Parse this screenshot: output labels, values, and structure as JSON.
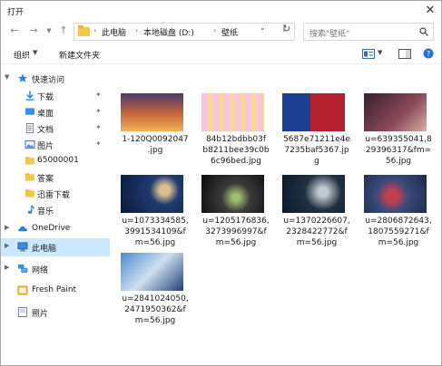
{
  "window": {
    "title": "打开",
    "close_glyph": "✕"
  },
  "address": {
    "breadcrumbs": [
      "此电脑",
      "本地磁盘 (D:)",
      "壁纸"
    ],
    "search_placeholder": "搜索\"壁纸\""
  },
  "toolbar": {
    "organize_label": "组织",
    "new_folder_label": "新建文件夹"
  },
  "sidebar": {
    "items": [
      {
        "label": "快速访问",
        "icon": "star-icon"
      },
      {
        "label": "下载",
        "icon": "download-icon",
        "pinned": true
      },
      {
        "label": "桌面",
        "icon": "desktop-icon",
        "pinned": true
      },
      {
        "label": "文档",
        "icon": "document-icon",
        "pinned": true
      },
      {
        "label": "图片",
        "icon": "picture-icon",
        "pinned": true
      },
      {
        "label": "65000001",
        "icon": "folder-icon"
      },
      {
        "label": "答案",
        "icon": "folder-icon"
      },
      {
        "label": "迅雷下载",
        "icon": "folder-icon"
      },
      {
        "label": "音乐",
        "icon": "music-icon"
      },
      {
        "label": "OneDrive",
        "icon": "cloud-icon"
      },
      {
        "label": "此电脑",
        "icon": "computer-icon",
        "selected": true
      },
      {
        "label": "网络",
        "icon": "network-icon"
      },
      {
        "label": "Fresh Paint",
        "icon": "app-icon"
      },
      {
        "label": "照片",
        "icon": "photos-icon"
      }
    ]
  },
  "files": [
    {
      "name": "1-120Q0092047\n.jpg",
      "colors": [
        "#3a2a4a",
        "#e8863a",
        "#f3b25a"
      ]
    },
    {
      "name": "84b12bdbb03f\nb8211bee39c0b\n6c96bed.jpg",
      "colors": [
        "#f6c8d6",
        "#f2a8c0",
        "#f7d98a"
      ]
    },
    {
      "name": "5687e71211e4e\n7235baf5367.jp\ng",
      "colors": [
        "#1d3f93",
        "#b5212e",
        "#f0f0f0"
      ]
    },
    {
      "name": "u=639355041,8\n29396317&fm=\n56.jpg",
      "colors": [
        "#4b2a3a",
        "#9a5a6a",
        "#d8b0a0"
      ]
    },
    {
      "name": "u=1073334585,\n3991534109&f\nm=56.jpg",
      "colors": [
        "#0a1a3a",
        "#203a70",
        "#d8c090"
      ]
    },
    {
      "name": "u=1205176836,\n3273996997&f\nm=56.jpg",
      "colors": [
        "#0a0a0a",
        "#3a3a3a",
        "#a0c070"
      ]
    },
    {
      "name": "u=1370226607,\n2328422772&f\nm=56.jpg",
      "colors": [
        "#0a1a2a",
        "#203040",
        "#c0c8d0"
      ]
    },
    {
      "name": "u=2806872643,\n1807559271&f\nm=56.jpg",
      "colors": [
        "#1a2a4a",
        "#3a4a7a",
        "#c04050"
      ]
    },
    {
      "name": "u=2841024050,\n2471950362&f\nm=56.jpg",
      "colors": [
        "#4a8ad0",
        "#d0e0f0",
        "#20407a"
      ]
    }
  ],
  "colors": {
    "selection": "#cce8ff",
    "folder": "#f2c94c",
    "accent": "#1e73d8"
  }
}
